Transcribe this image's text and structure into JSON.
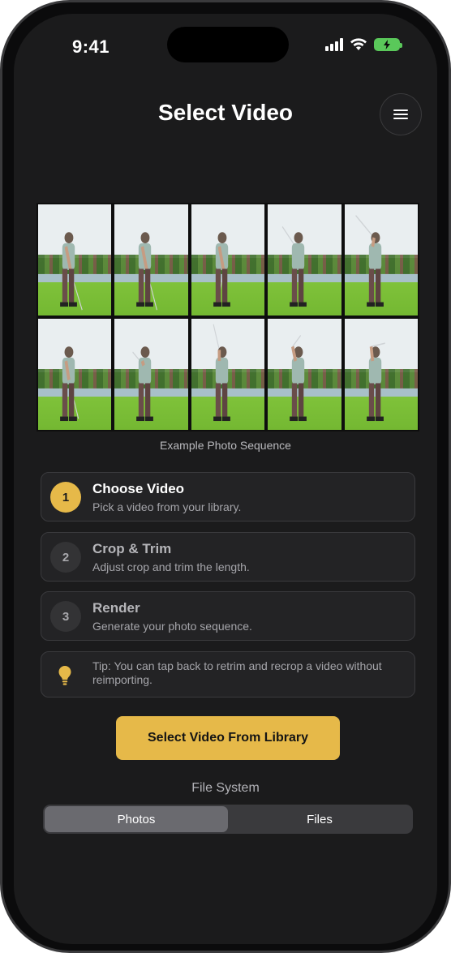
{
  "status_bar": {
    "time": "9:41"
  },
  "header": {
    "title": "Select Video"
  },
  "example": {
    "caption": "Example Photo Sequence",
    "frame_count": 10
  },
  "steps": [
    {
      "number": "1",
      "title": "Choose Video",
      "description": "Pick a video from your library.",
      "active": true
    },
    {
      "number": "2",
      "title": "Crop & Trim",
      "description": "Adjust crop and trim the length.",
      "active": false
    },
    {
      "number": "3",
      "title": "Render",
      "description": "Generate your photo sequence.",
      "active": false
    }
  ],
  "tip": {
    "text": "Tip: You can tap back to retrim and recrop a video without reimporting."
  },
  "primary_button": {
    "label": "Select Video From Library"
  },
  "file_system": {
    "label": "File System",
    "options": [
      "Photos",
      "Files"
    ],
    "selected": "Photos"
  },
  "colors": {
    "accent": "#E6B949",
    "background": "#1B1B1C",
    "card": "#232325"
  },
  "icons": [
    "signal-icon",
    "wifi-icon",
    "battery-icon",
    "menu-icon",
    "lightbulb-icon"
  ]
}
